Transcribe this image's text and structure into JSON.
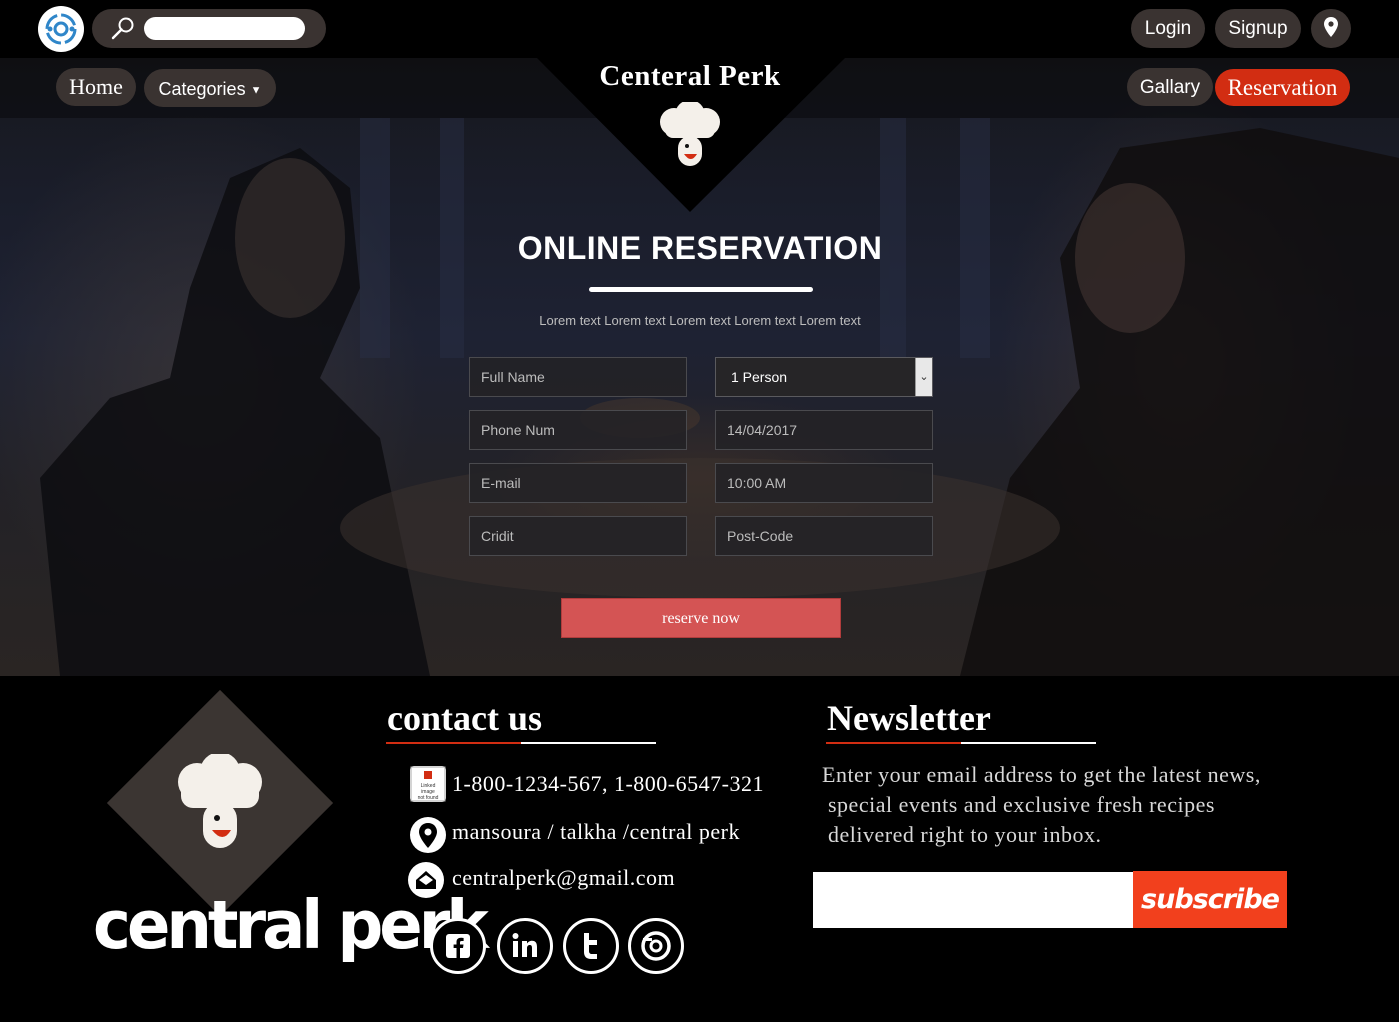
{
  "header": {
    "search": {
      "placeholder": ""
    },
    "login_label": "Login",
    "signup_label": "Signup"
  },
  "nav": {
    "home_label": "Home",
    "categories_label": "Categories",
    "gallery_label": "Gallary",
    "reservation_label": "Reservation"
  },
  "brand": {
    "title": "Centeral Perk"
  },
  "reservation": {
    "title": "ONLINE RESERVATION",
    "subtitle": "Lorem text Lorem text Lorem text Lorem text Lorem text",
    "full_name_placeholder": "Full Name",
    "persons_selected": "1 Person",
    "phone_placeholder": "Phone Num",
    "date_value": "14/04/2017",
    "email_placeholder": "E-mail",
    "time_value": "10:00 AM",
    "credit_placeholder": "Cridit",
    "postcode_placeholder": "Post-Code",
    "submit_label": "reserve now"
  },
  "footer": {
    "wordmark": "central perk",
    "contact": {
      "title": "contact us",
      "phone": "1-800-1234-567, 1-800-6547-321",
      "address": "mansoura / talkha /central perk",
      "email": "centralperk@gmail.com",
      "broken_image_text": "Linked image not found"
    },
    "newsletter": {
      "title": "Newsletter",
      "text_line1": "Enter your email address to get the latest news,",
      "text_line2": "special events and exclusive fresh recipes",
      "text_line3": "delivered right to your inbox.",
      "subscribe_label": "subscribe"
    },
    "social": [
      "facebook-icon",
      "linkedin-icon",
      "twitter-icon",
      "instagram-icon"
    ]
  },
  "colors": {
    "accent_red": "#d22d12",
    "button_red": "#d45454",
    "subscribe_orange": "#f2401d",
    "pill_gray": "#3a3331"
  }
}
